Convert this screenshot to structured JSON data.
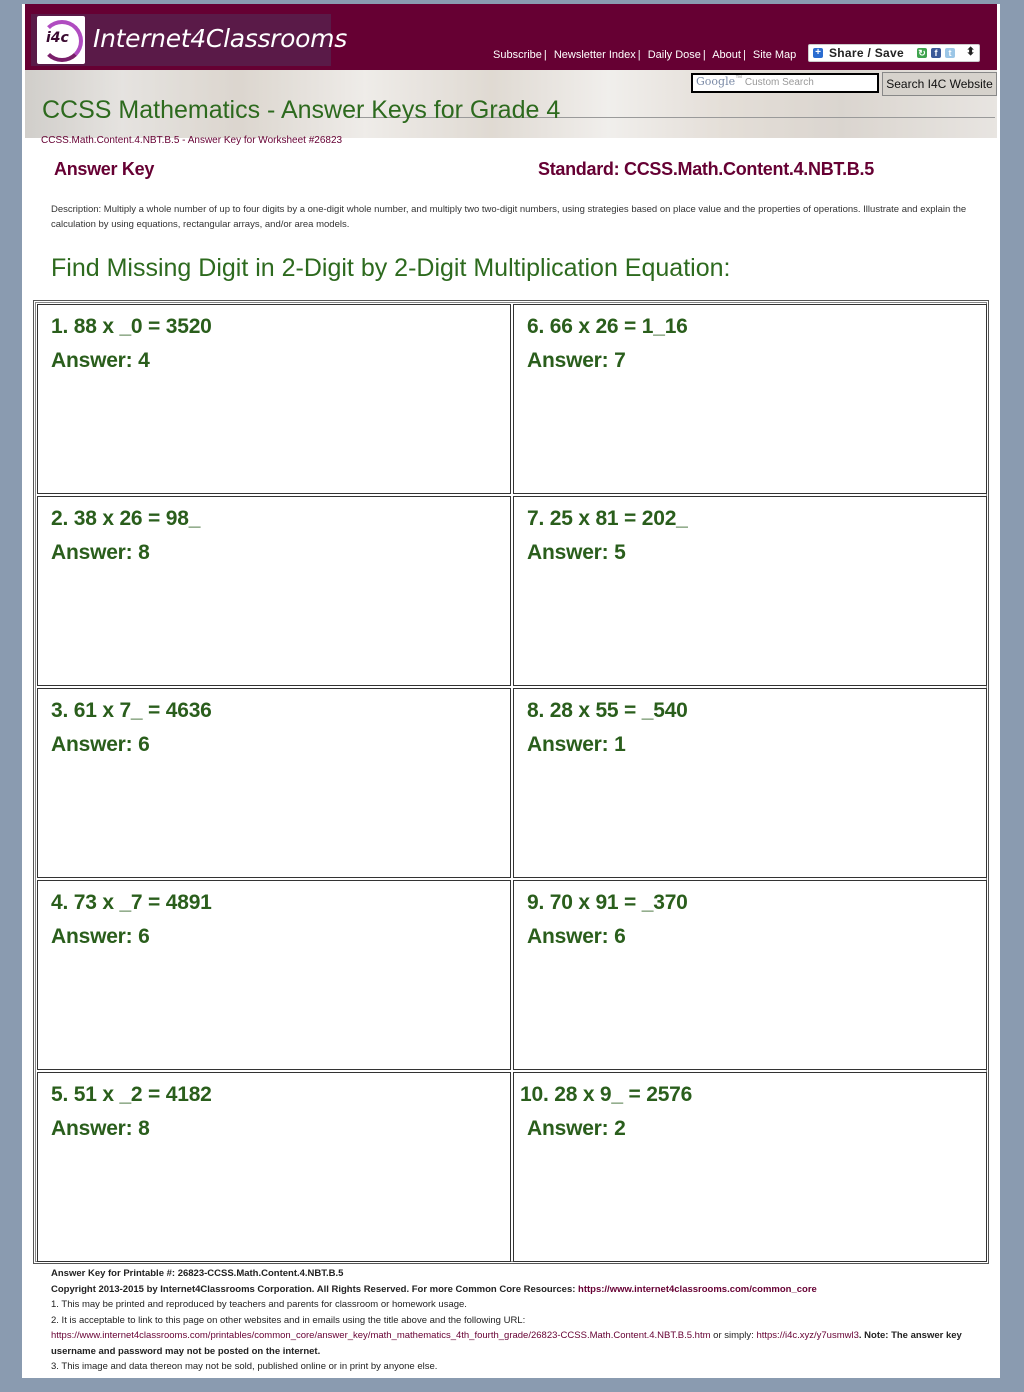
{
  "site": {
    "name": "Internet4Classrooms",
    "logo_text": "i4c",
    "nav": [
      "Subscribe",
      "Newsletter Index",
      "Daily Dose",
      "About",
      "Site Map"
    ],
    "share_label": "Share / Save",
    "search": {
      "placeholder_brand": "Google",
      "placeholder": "Custom Search",
      "button": "Search I4C Website"
    },
    "colors": {
      "brand": "#660033",
      "title_green": "#2d6a1e",
      "answer_green": "#2a5e1c",
      "background": "#8a9bb0"
    }
  },
  "page": {
    "title": "CCSS Mathematics - Answer Keys for Grade 4",
    "breadcrumb": "CCSS.Math.Content.4.NBT.B.5 - Answer Key for Worksheet #26823",
    "answer_key_label": "Answer Key",
    "standard_label": "Standard: CCSS.Math.Content.4.NBT.B.5",
    "description": "Description: Multiply a whole number of up to four digits by a one-digit whole number, and multiply two two-digit numbers, using strategies based on place value and the properties of operations. Illustrate and explain the calculation by using equations, rectangular arrays, and/or area models.",
    "section_title": "Find Missing Digit in 2-Digit by 2-Digit Multiplication Equation:"
  },
  "problems": [
    {
      "question": "1. 88 x _0 = 3520",
      "answer": "Answer: 4"
    },
    {
      "question": "2. 38 x 26 = 98_",
      "answer": "Answer: 8"
    },
    {
      "question": "3. 61 x 7_ = 4636",
      "answer": "Answer: 6"
    },
    {
      "question": "4. 73 x _7 = 4891",
      "answer": "Answer: 6"
    },
    {
      "question": "5. 51 x _2 = 4182",
      "answer": "Answer: 8"
    },
    {
      "question": "6. 66 x 26 = 1_16",
      "answer": "Answer: 7"
    },
    {
      "question": "7. 25 x 81 = 202_",
      "answer": "Answer: 5"
    },
    {
      "question": "8. 28 x 55 = _540",
      "answer": "Answer: 1"
    },
    {
      "question": "9. 70 x 91 = _370",
      "answer": "Answer: 6"
    },
    {
      "question": "10. 28 x 9_ = 2576",
      "answer": "Answer: 2"
    }
  ],
  "footer": {
    "printable": "Answer Key for Printable #: 26823-CCSS.Math.Content.4.NBT.B.5",
    "copyright": "Copyright 2013-2015 by Internet4Classrooms Corporation. All Rights Reserved. For more Common Core Resources: ",
    "copyright_link": "https://www.internet4classrooms.com/common_core",
    "note1": "1. This may be printed and reproduced by teachers and parents for classroom or homework usage.",
    "note2": "2. It is acceptable to link to this page on other websites and in emails using the title above and the following URL:",
    "url": "https://www.internet4classrooms.com/printables/common_core/answer_key/math_mathematics_4th_fourth_grade/26823-CCSS.Math.Content.4.NBT.B.5.htm",
    "or_simply": " or simply: ",
    "short_url": "https://i4c.xyz/y7usmwl3",
    "note_bold": ". Note: The answer key username and password may not be posted on the internet.",
    "note3": "3. This image and data thereon may not be sold, published online or in print by anyone else."
  }
}
